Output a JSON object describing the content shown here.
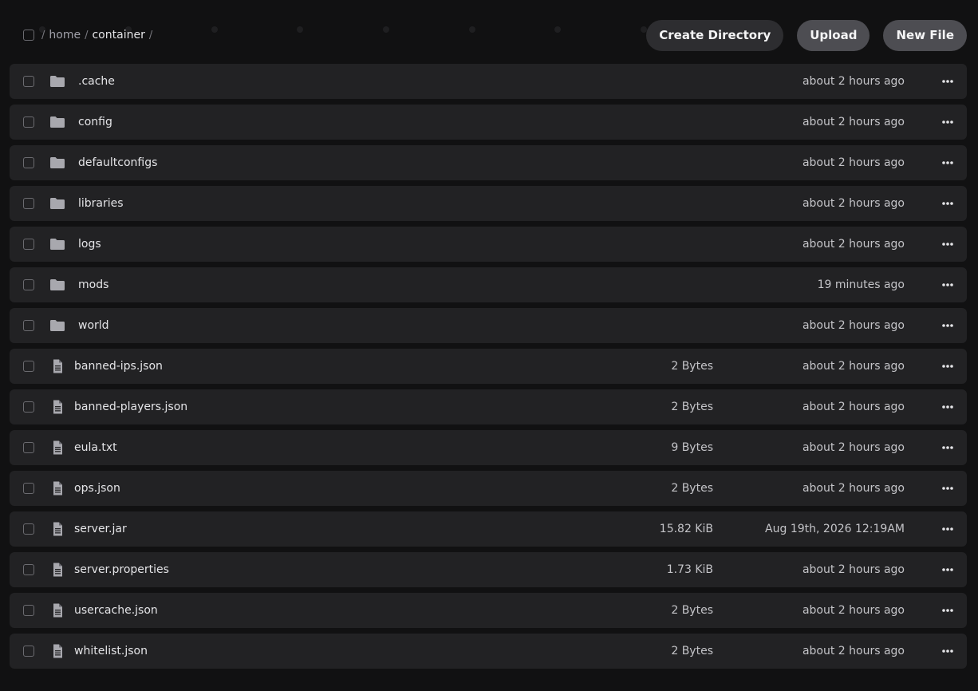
{
  "breadcrumb": {
    "separator": "/",
    "home": "home",
    "current": "container"
  },
  "actions": {
    "create_directory": "Create Directory",
    "upload": "Upload",
    "new_file": "New File"
  },
  "icons": {
    "folder": "folder-icon",
    "file": "file-icon",
    "more": "more-options-icon"
  },
  "colors": {
    "background": "#111112",
    "row": "#222224",
    "button_dark": "#2d2d30",
    "button_gray": "#4d4d52",
    "icon": "#a8a8ae"
  },
  "files": [
    {
      "type": "dir",
      "name": ".cache",
      "size": "",
      "modified": "about 2 hours ago"
    },
    {
      "type": "dir",
      "name": "config",
      "size": "",
      "modified": "about 2 hours ago"
    },
    {
      "type": "dir",
      "name": "defaultconfigs",
      "size": "",
      "modified": "about 2 hours ago"
    },
    {
      "type": "dir",
      "name": "libraries",
      "size": "",
      "modified": "about 2 hours ago"
    },
    {
      "type": "dir",
      "name": "logs",
      "size": "",
      "modified": "about 2 hours ago"
    },
    {
      "type": "dir",
      "name": "mods",
      "size": "",
      "modified": "19 minutes ago"
    },
    {
      "type": "dir",
      "name": "world",
      "size": "",
      "modified": "about 2 hours ago"
    },
    {
      "type": "file",
      "name": "banned-ips.json",
      "size": "2 Bytes",
      "modified": "about 2 hours ago"
    },
    {
      "type": "file",
      "name": "banned-players.json",
      "size": "2 Bytes",
      "modified": "about 2 hours ago"
    },
    {
      "type": "file",
      "name": "eula.txt",
      "size": "9 Bytes",
      "modified": "about 2 hours ago"
    },
    {
      "type": "file",
      "name": "ops.json",
      "size": "2 Bytes",
      "modified": "about 2 hours ago"
    },
    {
      "type": "file",
      "name": "server.jar",
      "size": "15.82 KiB",
      "modified": "Aug 19th, 2026 12:19AM"
    },
    {
      "type": "file",
      "name": "server.properties",
      "size": "1.73 KiB",
      "modified": "about 2 hours ago"
    },
    {
      "type": "file",
      "name": "usercache.json",
      "size": "2 Bytes",
      "modified": "about 2 hours ago"
    },
    {
      "type": "file",
      "name": "whitelist.json",
      "size": "2 Bytes",
      "modified": "about 2 hours ago"
    }
  ]
}
